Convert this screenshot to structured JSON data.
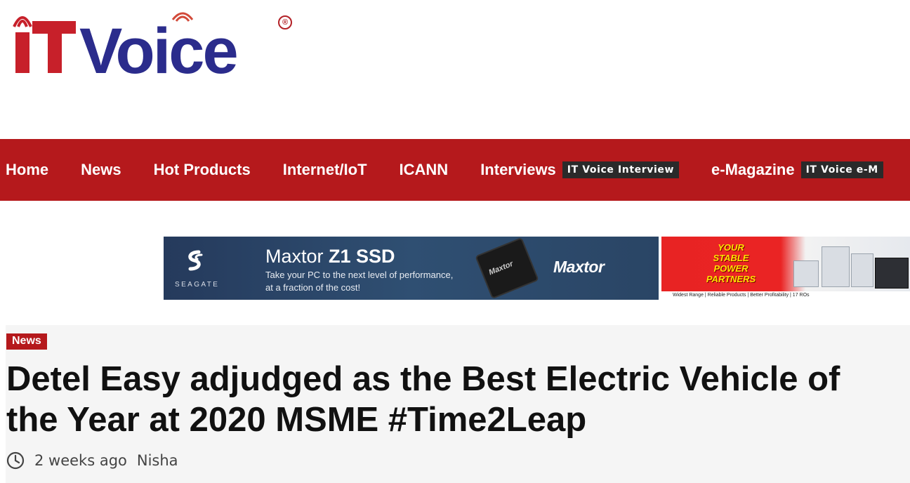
{
  "logo": {
    "text": "iTVoice",
    "registered": "®"
  },
  "nav": {
    "items": [
      {
        "label": "Home"
      },
      {
        "label": "News"
      },
      {
        "label": "Hot Products"
      },
      {
        "label": "Internet/IoT"
      },
      {
        "label": "ICANN"
      },
      {
        "label": "Interviews",
        "tag": "IT Voice Interview"
      },
      {
        "label": "e-Magazine",
        "tag": "IT Voice e-M"
      }
    ]
  },
  "banner_seagate": {
    "logo_text": "SEAGATE",
    "title_prefix": "Maxtor ",
    "title_strong": "Z1 SSD",
    "subtitle_line1": "Take your PC to the next level of performance,",
    "subtitle_line2": "at a fraction of the cost!",
    "chip_label": "Maxtor",
    "brand": "Maxtor"
  },
  "banner_power": {
    "line1": "YOUR",
    "line2": "STABLE",
    "line3": "POWER",
    "line4": "PARTNERS",
    "footer": "Widest Range | Reliable Products | Better Profitability | 17 ROs"
  },
  "article": {
    "category": "News",
    "title": "Detel Easy adjudged as the Best Electric Vehicle of the Year at 2020 MSME #Time2Leap",
    "time": "2 weeks ago",
    "author": "Nisha"
  },
  "colors": {
    "brand_red": "#b5191c",
    "logo_blue": "#2b2c8c",
    "dark_tag": "#2a2a2a"
  }
}
